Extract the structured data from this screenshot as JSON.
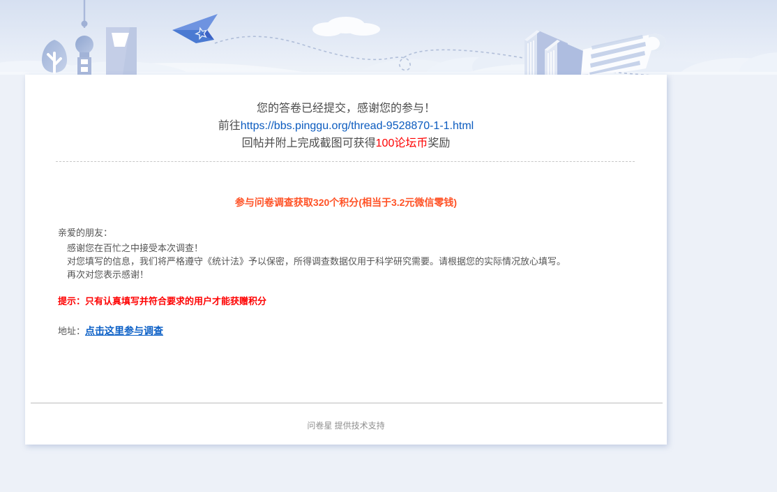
{
  "colors": {
    "page_background": "#edf1f8",
    "card_background": "#ffffff",
    "link_blue": "#0b5bbf",
    "bottom_link_blue": "#0c60c6",
    "reward_red": "#fe0000",
    "promo_orange": "#ff5226",
    "tip_red": "#fe0202",
    "body_text": "#555555",
    "footer_text": "#8f8f8f",
    "plane_blue": "#4a7ad2"
  },
  "header_illustration": {
    "icons": [
      "tree-icon",
      "pearl-tower-icon",
      "building-icon",
      "paper-plane-icon",
      "flight-trail",
      "cloud-icon",
      "books-icon",
      "scroll-document-icon"
    ]
  },
  "result_card": {
    "submit_message": "您的答卷已经提交，感谢您的参与！",
    "goto_line": {
      "prefix": "前往",
      "url": "https://bbs.pinggu.org/thread-9528870-1-1.html"
    },
    "reward_line": {
      "prefix": "回帖并附上完成截图可获得",
      "highlight": "100论坛币",
      "suffix": "奖励"
    },
    "promo_line": "参与问卷调查获取320个积分(相当于3.2元微信零钱)",
    "letter": {
      "salutation": "亲爱的朋友：",
      "lines": [
        "感谢您在百忙之中接受本次调查！",
        "对您填写的信息，我们将严格遵守《统计法》予以保密，所得调查数据仅用于科学研究需要。请根据您的实际情况放心填写。",
        "再次对您表示感谢！"
      ]
    },
    "tip_line": "提示：只有认真填写并符合要求的用户才能获赠积分",
    "address": {
      "label": "地址：",
      "link_text": "点击这里参与调查"
    }
  },
  "footer": {
    "text": "问卷星 提供技术支持"
  }
}
